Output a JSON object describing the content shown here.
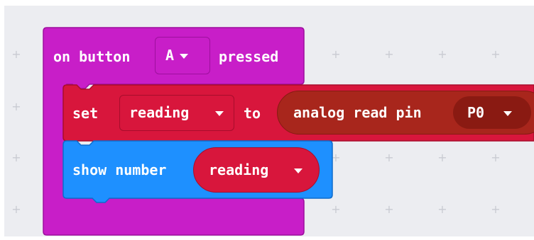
{
  "workspace": {
    "background": "#ecedf1",
    "grid_symbol": "+"
  },
  "event_block": {
    "color": "#c81ec8",
    "prefix": "on button",
    "dropdown_value": "A",
    "suffix": "pressed"
  },
  "set_block": {
    "color": "#d8163c",
    "keyword": "set",
    "variable": "reading",
    "connector": "to"
  },
  "analog_block": {
    "color": "#a8261c",
    "label": "analog read pin",
    "pin": "P0"
  },
  "show_block": {
    "color": "#1e90ff",
    "label": "show number",
    "variable": "reading"
  },
  "icons": [
    "dropdown-caret-icon",
    "grid-plus-icon"
  ]
}
